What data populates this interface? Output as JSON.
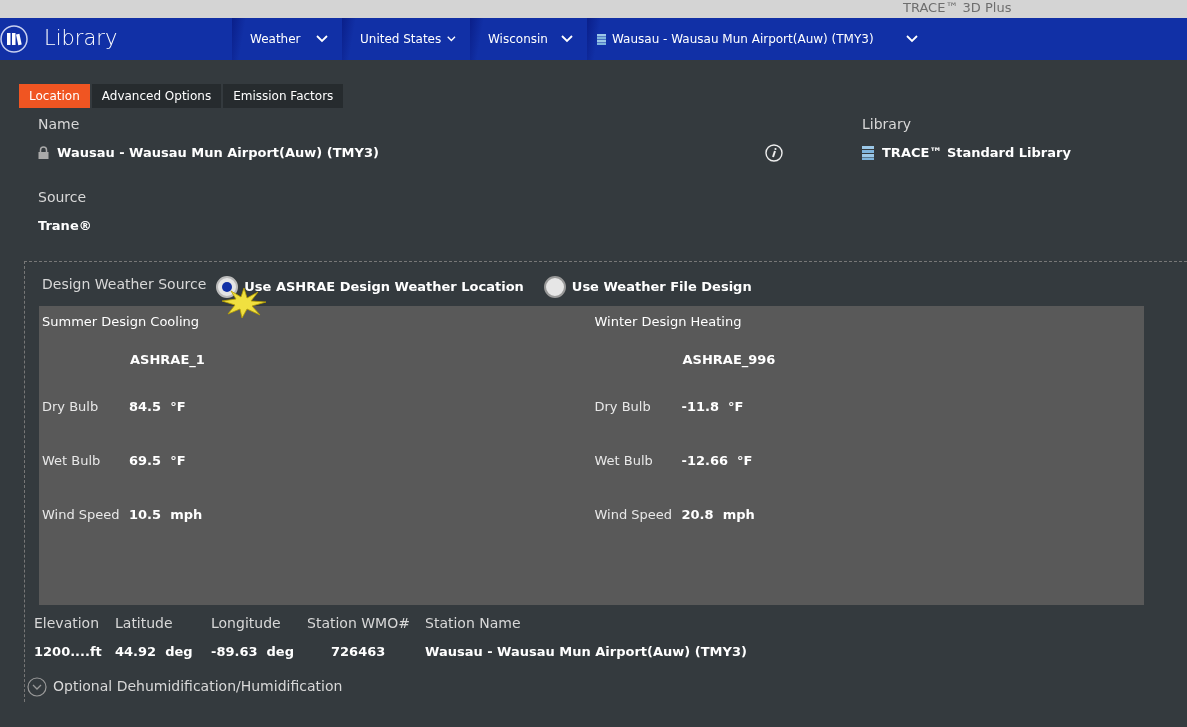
{
  "app_title": "TRACE™ 3D Plus",
  "header": {
    "title": "Library",
    "breadcrumbs": [
      {
        "label": "Weather",
        "kind": "plain"
      },
      {
        "label": "United States",
        "kind": "plain"
      },
      {
        "label": "Wisconsin",
        "kind": "plain"
      },
      {
        "label": "Wausau - Wausau Mun Airport(Auw) (TMY3)",
        "kind": "file"
      }
    ]
  },
  "tabs": [
    {
      "label": "Location",
      "selected": true
    },
    {
      "label": "Advanced Options",
      "selected": false
    },
    {
      "label": "Emission Factors",
      "selected": false
    }
  ],
  "name": {
    "label": "Name",
    "value": "Wausau - Wausau Mun Airport(Auw) (TMY3)",
    "locked": true
  },
  "library": {
    "label": "Library",
    "value": "TRACE™ Standard Library"
  },
  "source": {
    "label": "Source",
    "value": "Trane®"
  },
  "design_weather": {
    "label": "Design Weather Source",
    "options": [
      {
        "label": "Use ASHRAE Design Weather Location",
        "selected": true
      },
      {
        "label": "Use Weather File Design",
        "selected": false
      }
    ],
    "panels": [
      {
        "heading": "Summer Design Cooling",
        "design": "ASHRAE_1",
        "rows": [
          {
            "label": "Dry Bulb",
            "value": "84.5",
            "unit": "°F"
          },
          {
            "label": "Wet Bulb",
            "value": "69.5",
            "unit": "°F"
          },
          {
            "label": "Wind Speed",
            "value": "10.5",
            "unit": "mph"
          }
        ]
      },
      {
        "heading": "Winter Design Heating",
        "design": "ASHRAE_996",
        "rows": [
          {
            "label": "Dry Bulb",
            "value": "-11.8",
            "unit": "°F"
          },
          {
            "label": "Wet Bulb",
            "value": "-12.66",
            "unit": "°F"
          },
          {
            "label": "Wind Speed",
            "value": "20.8",
            "unit": "mph"
          }
        ]
      }
    ]
  },
  "station": [
    {
      "label": "Elevation",
      "value": "1200....ft"
    },
    {
      "label": "Latitude",
      "value": "44.92",
      "unit": "deg"
    },
    {
      "label": "Longitude",
      "value": "-89.63",
      "unit": "deg"
    },
    {
      "label": "Station WMO#",
      "value": "726463"
    },
    {
      "label": "Station Name",
      "value": "Wausau - Wausau Mun Airport(Auw) (TMY3)"
    }
  ],
  "optional": {
    "label": "Optional Dehumidification/Humidification",
    "expanded": false
  }
}
